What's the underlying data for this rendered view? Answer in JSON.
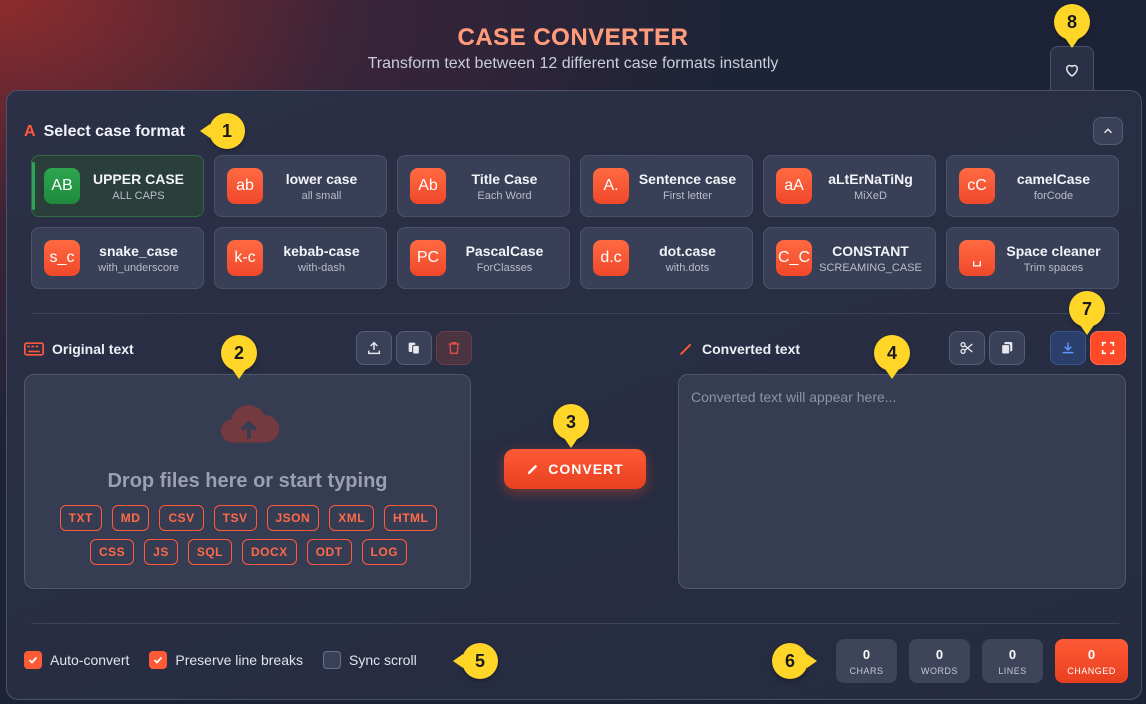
{
  "header": {
    "title": "CASE CONVERTER",
    "subtitle": "Transform text between 12 different case formats instantly"
  },
  "format_section": {
    "title": "Select case format",
    "icon": "case-a-icon"
  },
  "formats": [
    {
      "icon": "AB",
      "name": "UPPER CASE",
      "sub": "ALL CAPS",
      "active": true
    },
    {
      "icon": "ab",
      "name": "lower case",
      "sub": "all small"
    },
    {
      "icon": "Ab",
      "name": "Title Case",
      "sub": "Each Word"
    },
    {
      "icon": "A.",
      "name": "Sentence case",
      "sub": "First letter"
    },
    {
      "icon": "aA",
      "name": "aLtErNaTiNg",
      "sub": "MiXeD"
    },
    {
      "icon": "cC",
      "name": "camelCase",
      "sub": "forCode"
    },
    {
      "icon": "s_c",
      "name": "snake_case",
      "sub": "with_underscore"
    },
    {
      "icon": "k-c",
      "name": "kebab-case",
      "sub": "with-dash"
    },
    {
      "icon": "PC",
      "name": "PascalCase",
      "sub": "ForClasses"
    },
    {
      "icon": "d.c",
      "name": "dot.case",
      "sub": "with.dots"
    },
    {
      "icon": "C_C",
      "name": "CONSTANT",
      "sub": "SCREAMING_CASE"
    },
    {
      "icon": "␣",
      "name": "Space cleaner",
      "sub": "Trim spaces"
    }
  ],
  "input": {
    "label": "Original text",
    "drop_text": "Drop files here or start typing",
    "file_types": [
      "TXT",
      "MD",
      "CSV",
      "TSV",
      "JSON",
      "XML",
      "HTML",
      "CSS",
      "JS",
      "SQL",
      "DOCX",
      "ODT",
      "LOG"
    ]
  },
  "convert_button": "CONVERT",
  "output": {
    "label": "Converted text",
    "placeholder": "Converted text will appear here..."
  },
  "options": [
    {
      "label": "Auto-convert",
      "checked": true
    },
    {
      "label": "Preserve line breaks",
      "checked": true
    },
    {
      "label": "Sync scroll",
      "checked": false
    }
  ],
  "stats": [
    {
      "value": "0",
      "label": "CHARS"
    },
    {
      "value": "0",
      "label": "WORDS"
    },
    {
      "value": "0",
      "label": "LINES"
    },
    {
      "value": "0",
      "label": "CHANGED"
    }
  ],
  "markers": [
    "1",
    "2",
    "3",
    "4",
    "5",
    "6",
    "7",
    "8"
  ],
  "colors": {
    "accent": "#ff5a36",
    "active_green": "#2ea64f",
    "marker_yellow": "#ffd628"
  }
}
